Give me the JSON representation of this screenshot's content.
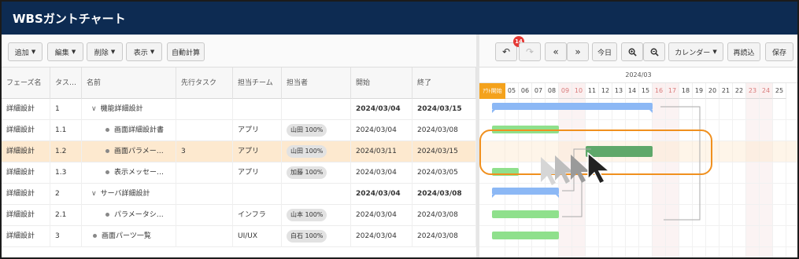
{
  "app": {
    "title": "WBSガントチャート"
  },
  "toolbar": {
    "add": "追加",
    "edit": "編集",
    "delete": "削除",
    "view": "表示",
    "auto_calc": "自動計算",
    "undo_badge": "14",
    "today": "今日",
    "calendar": "カレンダー",
    "reload": "再読込",
    "save": "保存"
  },
  "columns": [
    "フェーズ名",
    "タス…",
    "名前",
    "先行タスク",
    "担当チーム",
    "担当者",
    "開始",
    "終了"
  ],
  "rows": [
    {
      "phase": "詳細設計",
      "no": "1",
      "name": "機能詳細設計",
      "pred": "",
      "team": "",
      "assignee": "",
      "start": "2024/03/04",
      "end": "2024/03/15",
      "kind": "group"
    },
    {
      "phase": "詳細設計",
      "no": "1.1",
      "name": "画面詳細設計書",
      "pred": "",
      "team": "アプリ",
      "assignee": "山田 100%",
      "start": "2024/03/04",
      "end": "2024/03/08",
      "kind": "child"
    },
    {
      "phase": "詳細設計",
      "no": "1.2",
      "name": "画面パラメー…",
      "pred": "3",
      "team": "アプリ",
      "assignee": "山田 100%",
      "start": "2024/03/11",
      "end": "2024/03/15",
      "kind": "child"
    },
    {
      "phase": "詳細設計",
      "no": "1.3",
      "name": "表示メッセー…",
      "pred": "",
      "team": "アプリ",
      "assignee": "加藤 100%",
      "start": "2024/03/04",
      "end": "2024/03/05",
      "kind": "child"
    },
    {
      "phase": "詳細設計",
      "no": "2",
      "name": "サーバ詳細設計",
      "pred": "",
      "team": "",
      "assignee": "",
      "start": "2024/03/04",
      "end": "2024/03/08",
      "kind": "group"
    },
    {
      "phase": "詳細設計",
      "no": "2.1",
      "name": "パラメータシ…",
      "pred": "",
      "team": "インフラ",
      "assignee": "山本 100%",
      "start": "2024/03/04",
      "end": "2024/03/08",
      "kind": "child"
    },
    {
      "phase": "詳細設計",
      "no": "3",
      "name": "画面パーツ一覧",
      "pred": "",
      "team": "UI/UX",
      "assignee": "白石 100%",
      "start": "2024/03/04",
      "end": "2024/03/08",
      "kind": "leaf"
    }
  ],
  "gantt": {
    "month": "2024/03",
    "today_label": "ｱｳﾄ開始",
    "days": [
      "04",
      "05",
      "06",
      "07",
      "08",
      "09",
      "10",
      "11",
      "12",
      "13",
      "14",
      "15",
      "16",
      "17",
      "18",
      "19",
      "20",
      "21",
      "22",
      "23",
      "24",
      "25"
    ],
    "weekend_days": [
      "09",
      "10",
      "16",
      "17",
      "23",
      "24"
    ]
  },
  "colors": {
    "titlebar": "#0d2b52",
    "summary_bar": "#8cb8f5",
    "task_bar": "#8fe08c",
    "drag_bar": "#5fa86a",
    "highlight": "#f0901e",
    "selected_row": "#fde9cf"
  }
}
